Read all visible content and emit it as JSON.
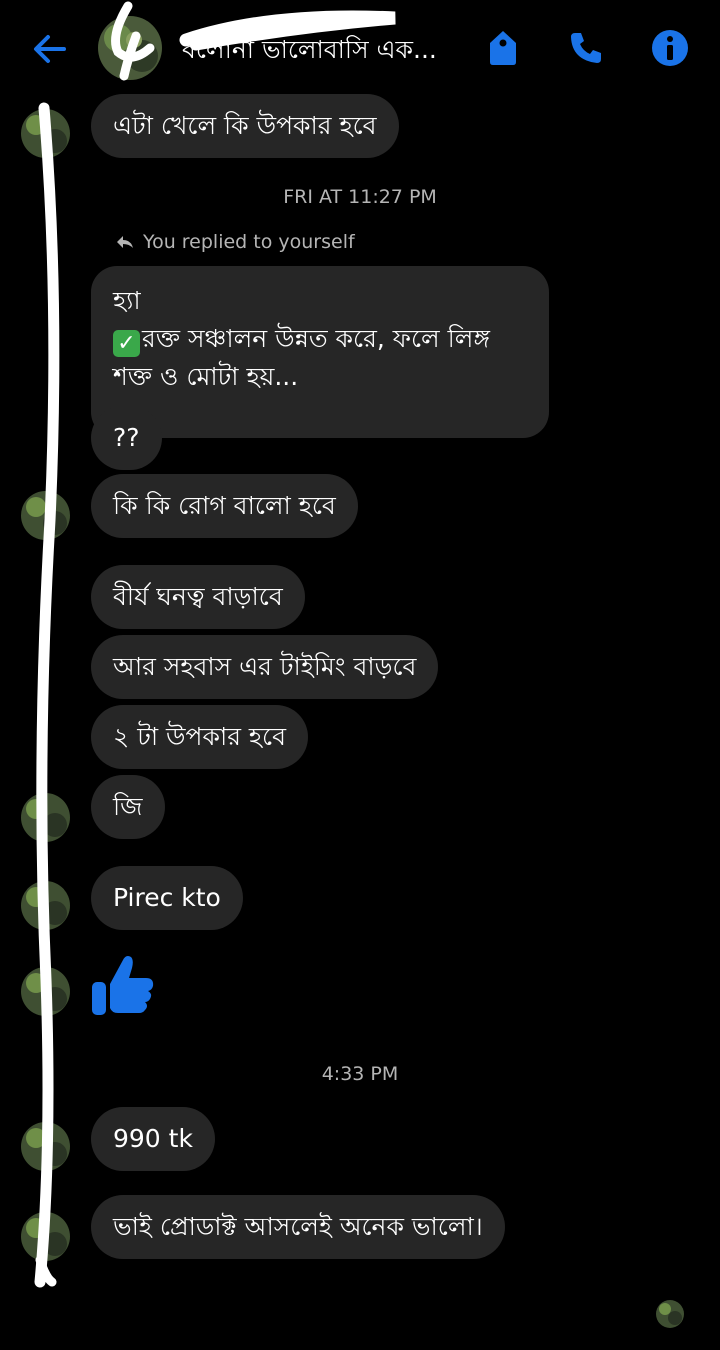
{
  "header": {
    "title": "বলোনা ভালোবাসি এক...",
    "back_icon": "arrow-left-icon",
    "icons": [
      "tag-icon",
      "phone-icon",
      "info-icon"
    ],
    "accent_color": "#1a73e8"
  },
  "thread": {
    "msg_1": "এটা খেলে কি উপকার হবে",
    "timestamp_1": "FRI AT 11:27 PM",
    "reply_note": "You replied to yourself",
    "reply_line_1": "হ্যা",
    "reply_line_2": "রক্ত সঞ্চালন উন্নত করে, ফলে লিঙ্গ শক্ত ও মোটা হয়...",
    "reply_check_icon": "check-box-icon",
    "msg_2": "??",
    "msg_3": "কি কি রোগ বালো হবে",
    "msg_4": "বীর্য ঘনত্ব বাড়াবে",
    "msg_5": "আর সহবাস এর টাইমিং বাড়বে",
    "msg_6": "২ টা উপকার হবে",
    "msg_7": "জি",
    "msg_8": "Pirec kto",
    "like_icon": "thumbs-up-icon",
    "timestamp_2": "4:33 PM",
    "msg_9": "990 tk",
    "msg_10": "ভাই প্রোডাক্ট আসলেই অনেক ভালো।"
  }
}
